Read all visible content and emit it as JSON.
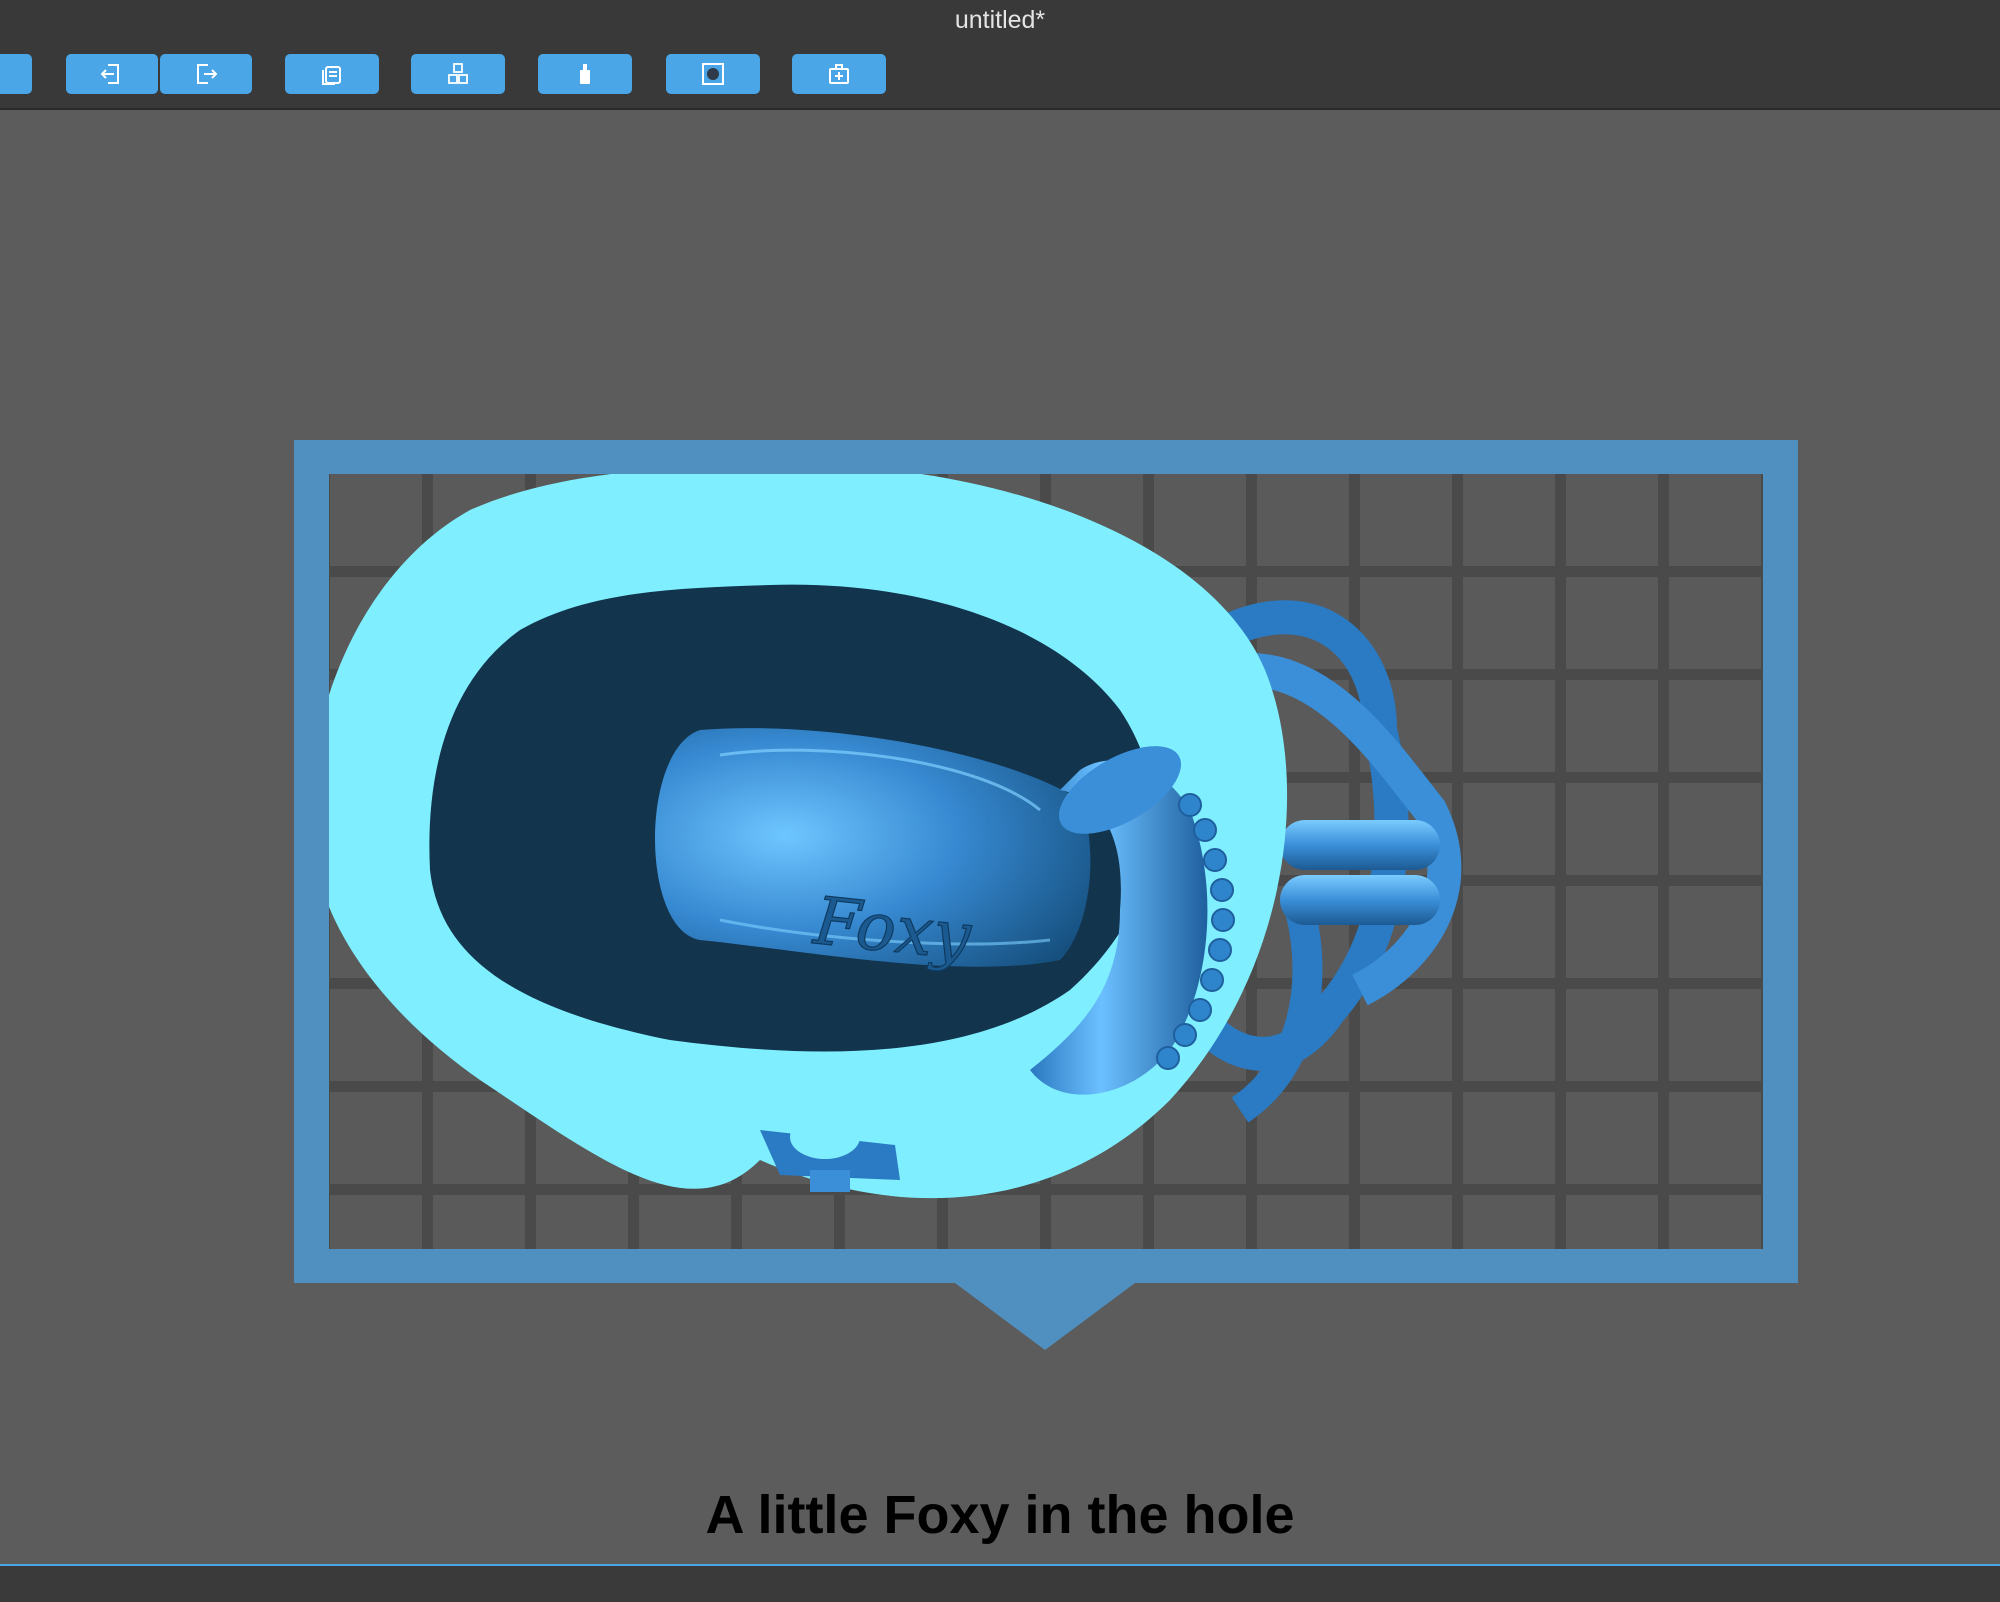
{
  "window": {
    "title": "untitled*"
  },
  "toolbar": {
    "buttons": [
      {
        "name": "toolbar-button-edge",
        "icon": "partial-button-icon"
      },
      {
        "name": "import-button",
        "icon": "import-icon"
      },
      {
        "name": "export-button",
        "icon": "export-icon"
      },
      {
        "name": "layers-button",
        "icon": "layers-icon"
      },
      {
        "name": "arrange-button",
        "icon": "cubes-icon"
      },
      {
        "name": "support-button",
        "icon": "support-icon"
      },
      {
        "name": "hollow-button",
        "icon": "hollow-icon"
      },
      {
        "name": "add-tool-button",
        "icon": "toolbox-add-icon"
      }
    ]
  },
  "model": {
    "engraving": "Foxy"
  },
  "caption": {
    "text": "A little Foxy in the hole"
  },
  "colors": {
    "accent": "#4aa6e6",
    "frame": "#5090c0",
    "rim": "#7fefff",
    "body": "#3a8fd8",
    "cavity": "#13344d",
    "grid": "#4a4a4a"
  }
}
